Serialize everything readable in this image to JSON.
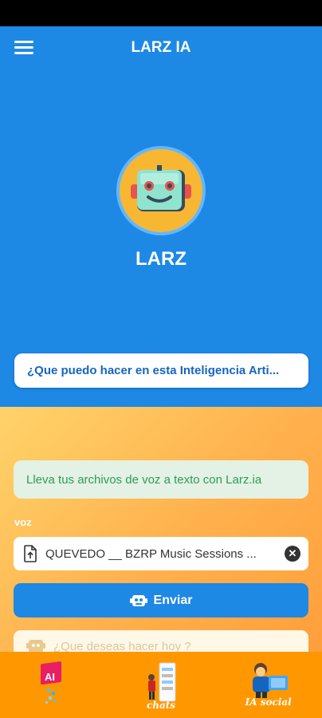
{
  "app": {
    "title": "LARZ IA"
  },
  "bot": {
    "name": "LARZ"
  },
  "question_card": {
    "text": "¿Que puedo hacer en esta Inteligencia Arti..."
  },
  "info_card": {
    "text": "Lleva tus archivos de voz a texto con Larz.ia"
  },
  "voz": {
    "label": "voz",
    "file_name": "QUEVEDO __ BZRP Music Sessions ...",
    "clear_icon": "close-circle-icon",
    "file_icon": "file-upload-icon"
  },
  "send_button": {
    "label": "Enviar",
    "icon": "robot-icon"
  },
  "prompt": {
    "placeholder": "¿Que deseas hacer hoy ?"
  },
  "bottom_nav": {
    "items": [
      {
        "id": "ai",
        "label": "",
        "icon": "ai-icon"
      },
      {
        "id": "chats",
        "label": "chats",
        "icon": "chats-illustration-icon"
      },
      {
        "id": "social",
        "label": "IA social",
        "icon": "social-illustration-icon"
      }
    ]
  },
  "colors": {
    "primary": "#1E88E5",
    "accent": "#FF9800",
    "success_text": "#2E9B5A",
    "avatar_bg": "#F7B733"
  }
}
